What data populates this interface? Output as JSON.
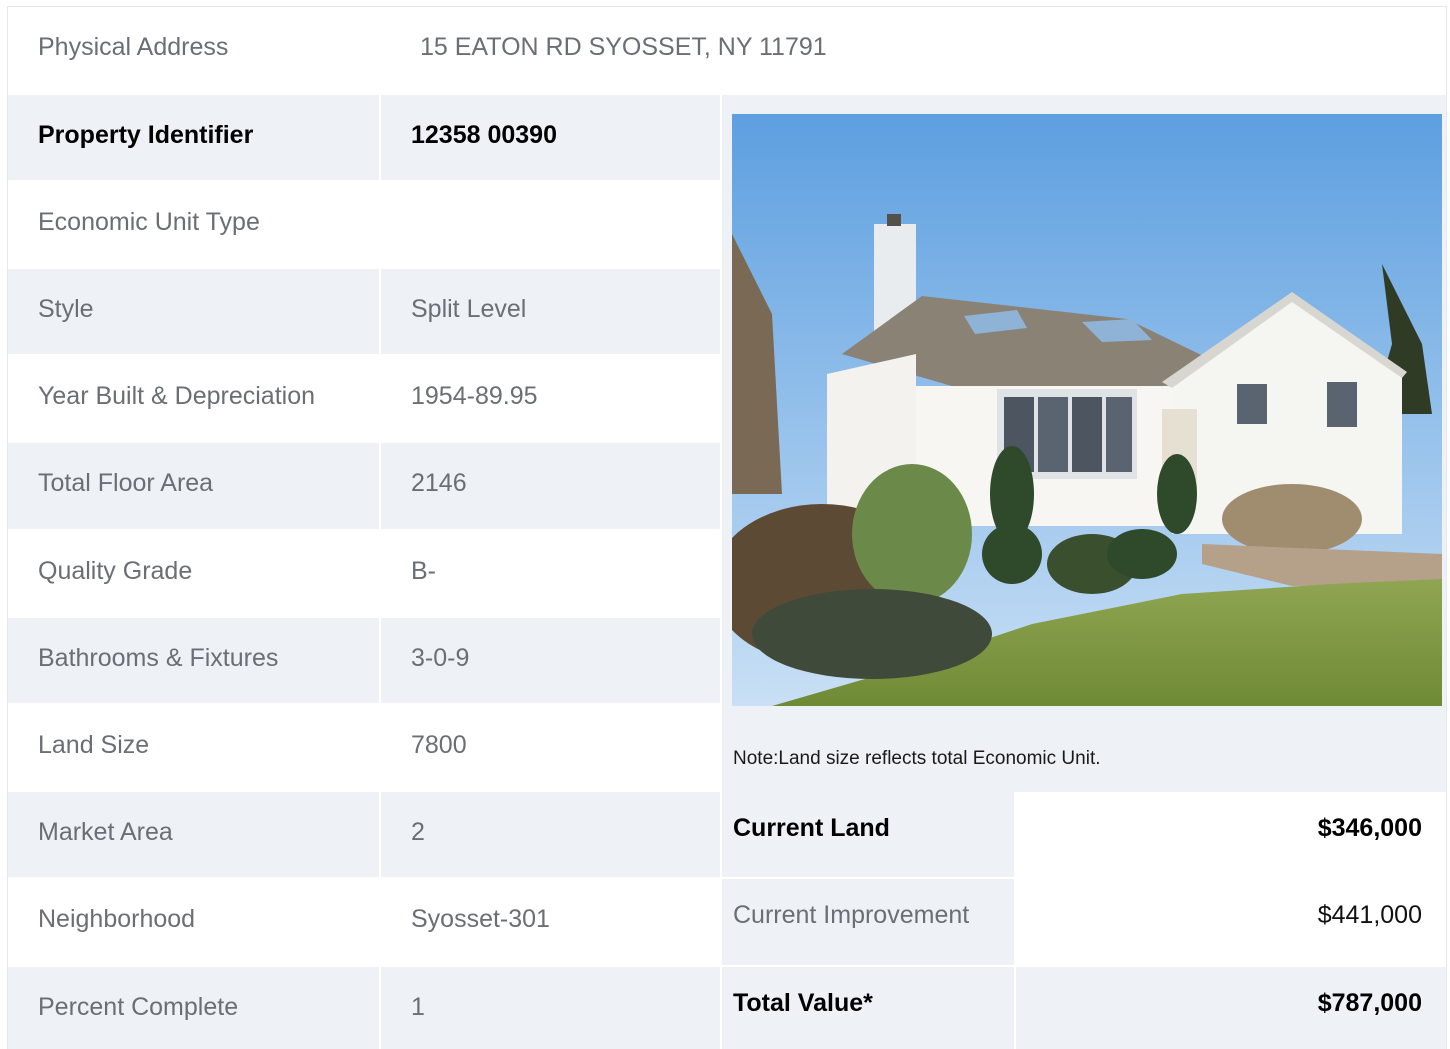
{
  "address": {
    "label": "Physical Address",
    "value": "15  EATON RD  SYOSSET, NY  11791"
  },
  "rows": [
    {
      "label": "Property Identifier",
      "value": "12358  00390"
    },
    {
      "label": "Economic Unit Type",
      "value": ""
    },
    {
      "label": "Style",
      "value": "Split Level"
    },
    {
      "label": "Year Built & Depreciation",
      "value": "1954-89.95"
    },
    {
      "label": "Total Floor Area",
      "value": "2146"
    },
    {
      "label": "Quality Grade",
      "value": "B-"
    },
    {
      "label": "Bathrooms & Fixtures",
      "value": "3-0-9"
    },
    {
      "label": "Land Size",
      "value": "7800"
    },
    {
      "label": "Market Area",
      "value": "2"
    },
    {
      "label": "Neighborhood",
      "value": "Syosset-301"
    },
    {
      "label": "Percent Complete",
      "value": "1"
    }
  ],
  "note": "Note:Land size reflects total Economic Unit.",
  "valuation": {
    "current_land_label": "Current Land",
    "current_land_value": "$346,000",
    "current_improvement_label": "Current Improvement",
    "current_improvement_value": "$441,000",
    "total_value_label": "Total Value*",
    "total_value_value": "$787,000"
  }
}
